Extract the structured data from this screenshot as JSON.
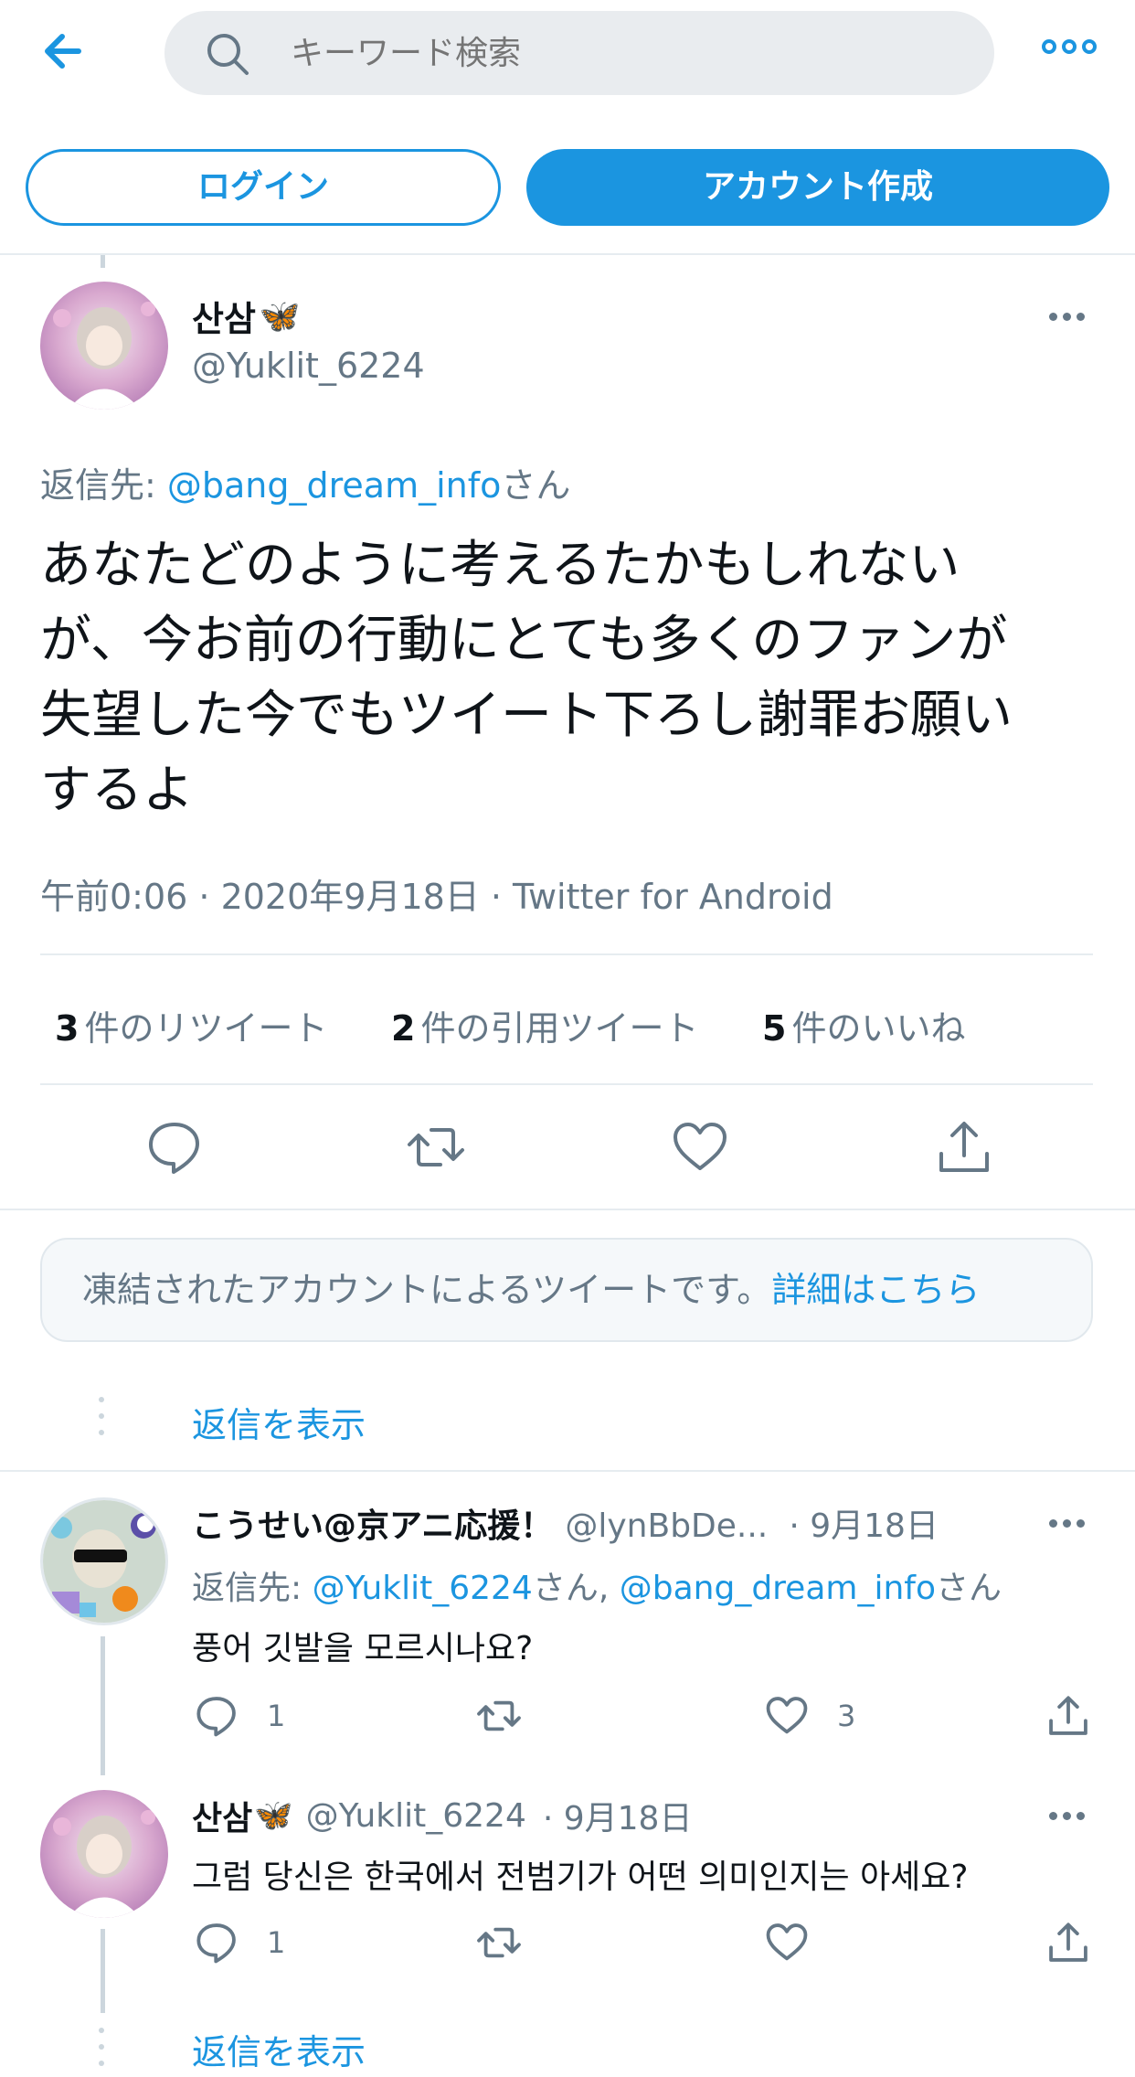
{
  "header": {
    "search_placeholder": "キーワード検索",
    "login_label": "ログイン",
    "signup_label": "アカウント作成"
  },
  "tweet": {
    "display_name": "산삼",
    "display_emoji": "🦋",
    "handle": "@Yuklit_6224",
    "reply_prefix": "返信先: ",
    "reply_to": "@bang_dream_info",
    "reply_suffix": "さん",
    "text_lines": [
      "あなたどのように考えるたかもしれない",
      "が、今お前の行動にとても多くのファンが",
      "失望した今でもツイート下ろし謝罪お願い",
      "するよ"
    ],
    "timestamp": "午前0:06 · 2020年9月18日 · Twitter for Android",
    "stats": {
      "retweets_count": "3",
      "retweets_label": "件のリツイート",
      "quotes_count": "2",
      "quotes_label": "件の引用ツイート",
      "likes_count": "5",
      "likes_label": "件のいいね"
    }
  },
  "notice": {
    "text": "凍結されたアカウントによるツイートです。",
    "link": "詳細はこちら"
  },
  "show_replies_label": "返信を表示",
  "replies": [
    {
      "display_name": "こうせい@京アニ応援！",
      "handle": "@lynBbDe...",
      "date": "· 9月18日",
      "reply_prefix": "返信先: ",
      "reply_to_1": "@Yuklit_6224",
      "reply_mid": "さん, ",
      "reply_to_2": "@bang_dream_info",
      "reply_suffix": "さん",
      "text": "풍어 깃발을 모르시나요?",
      "reply_count": "1",
      "retweet_count": "",
      "like_count": "3"
    },
    {
      "display_name": "산삼",
      "display_emoji": "🦋",
      "handle": "@Yuklit_6224",
      "date": "· 9月18日",
      "text": "그럼 당신은 한국에서 전범기가 어떤 의미인지는 아세요?",
      "reply_count": "1",
      "retweet_count": "",
      "like_count": ""
    }
  ],
  "colors": {
    "accent": "#1b95e0",
    "muted": "#657786",
    "divider": "#e6ecf0"
  },
  "icons": [
    "back-arrow-icon",
    "search-icon",
    "more-icon",
    "reply-icon",
    "retweet-icon",
    "like-icon",
    "share-icon"
  ]
}
